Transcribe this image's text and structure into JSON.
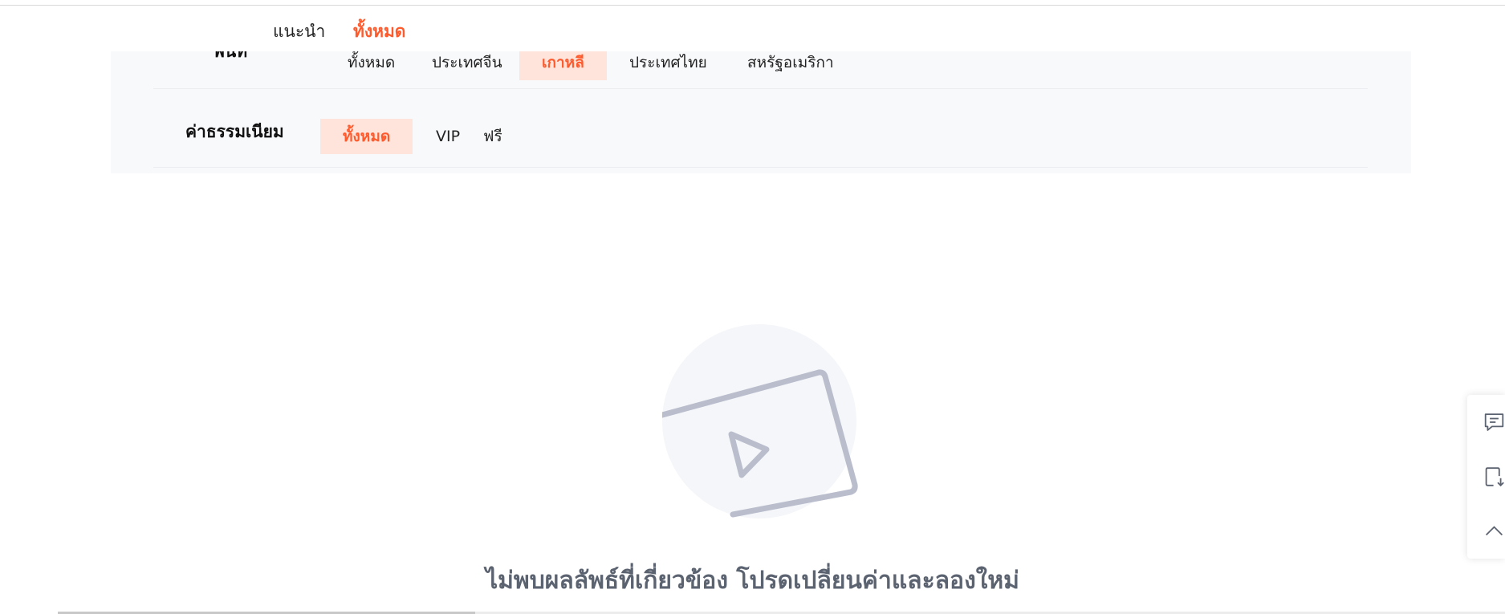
{
  "top_tabs": {
    "recommend": "แนะนำ",
    "all": "ทั้งหมด"
  },
  "filters": {
    "area": {
      "label": "พื้นที่",
      "options": [
        "ทั้งหมด",
        "ประเทศจีน",
        "เกาหลี",
        "ประเทศไทย",
        "สหรัฐอเมริกา"
      ],
      "selected": "เกาหลี"
    },
    "fee": {
      "label": "ค่าธรรมเนียม",
      "options": [
        "ทั้งหมด",
        "VIP",
        "ฟรี"
      ],
      "selected": "ทั้งหมด"
    }
  },
  "empty_state": {
    "icon": "video-play-icon",
    "message": "ไม่พบผลลัพธ์ที่เกี่ยวข้อง โปรดเปลี่ยนค่าและลองใหม่"
  },
  "side_toolbar": {
    "icons": [
      "feedback-icon",
      "download-app-icon",
      "back-to-top-icon"
    ]
  },
  "colors": {
    "accent": "#ff5a2c",
    "accent_bg": "#ffe4dc",
    "panel_bg": "#f8f9fb",
    "icon_gray": "#b9bdcc"
  }
}
